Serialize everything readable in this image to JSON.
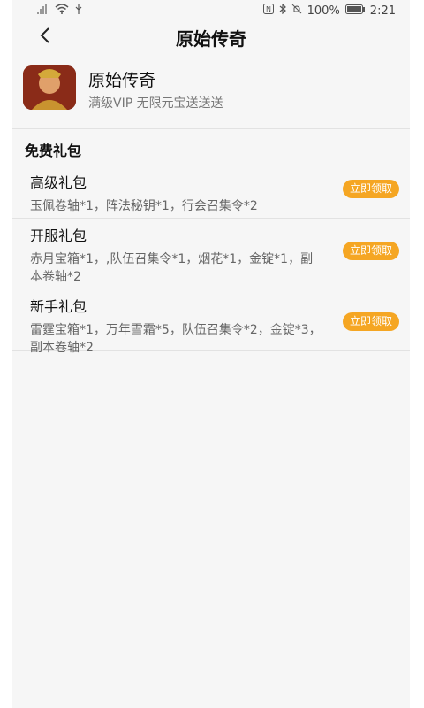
{
  "status": {
    "battery": "100%",
    "time": "2:21"
  },
  "nav": {
    "title": "原始传奇"
  },
  "app": {
    "name": "原始传奇",
    "desc": "满级VIP 无限元宝送送送"
  },
  "section": {
    "title": "免费礼包"
  },
  "gifts": [
    {
      "name": "高级礼包",
      "content": "玉佩卷轴*1，阵法秘钥*1，行会召集令*2",
      "button": "立即领取"
    },
    {
      "name": "开服礼包",
      "content": "赤月宝箱*1，,队伍召集令*1，烟花*1，金锭*1，副本卷轴*2",
      "button": "立即领取"
    },
    {
      "name": "新手礼包",
      "content": "雷霆宝箱*1，万年雪霜*5，队伍召集令*2，金锭*3，副本卷轴*2",
      "button": "立即领取"
    }
  ],
  "colors": {
    "accent": "#f5a623",
    "background": "#f6f6f6"
  }
}
